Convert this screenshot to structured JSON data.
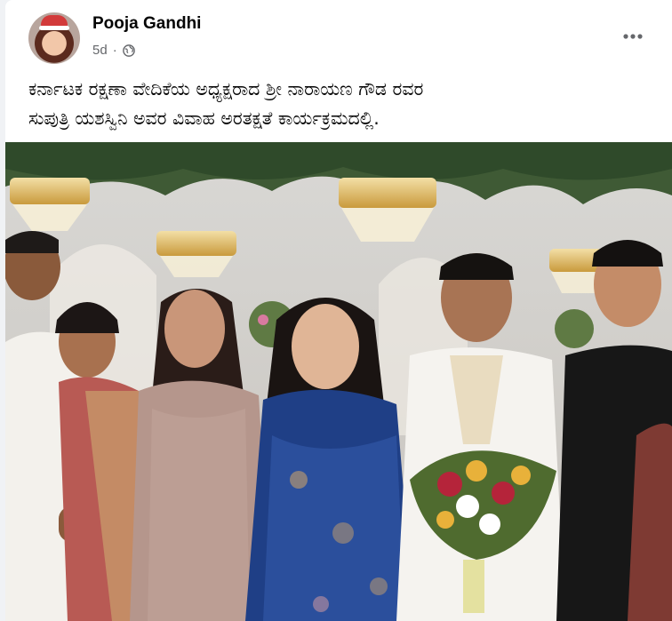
{
  "post": {
    "author": "Pooja Gandhi",
    "time": "5d",
    "separator": "·",
    "privacy_icon": "globe-icon",
    "more_icon": "more-options-icon",
    "caption": "ಕರ್ನಾಟಕ ರಕ್ಷಣಾ ವೇದಿಕೆಯ ಅಧ್ಯಕ್ಷರಾದ ಶ್ರೀ ನಾರಾಯಣ ಗೌಡ ರವರ\nಸುಪುತ್ರಿ ಯಶಸ್ವಿನಿ ಅವರ ವಿವಾಹ ಅರತಕ್ಷತೆ ಕಾರ್ಯಕ್ರಮದಲ್ಲಿ."
  },
  "colors": {
    "text_primary": "#050505",
    "text_secondary": "#65676b",
    "background": "#f0f2f5",
    "card": "#ffffff"
  }
}
